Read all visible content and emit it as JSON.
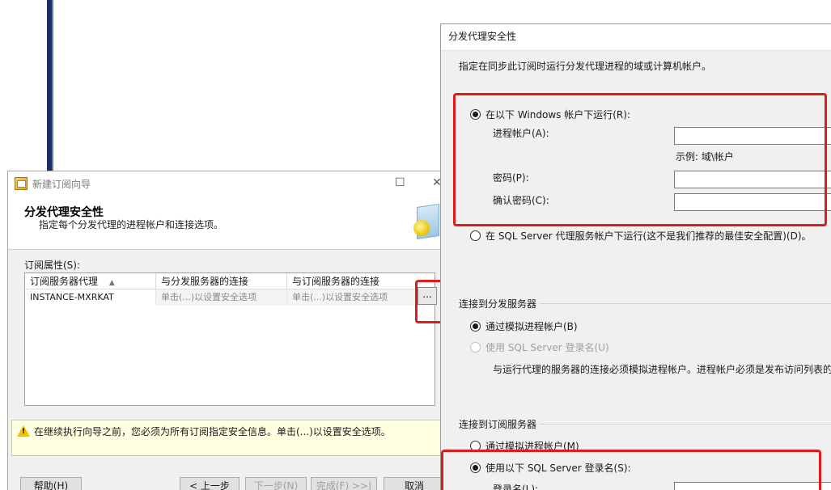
{
  "wizard": {
    "title": "新建订阅向导",
    "controls": {
      "maximize": "☐",
      "close": "✕"
    },
    "header_title": "分发代理安全性",
    "header_subtitle": "指定每个分发代理的进程帐户和连接选项。",
    "subscription_props_label": "订阅属性(S):",
    "grid": {
      "columns": [
        "订阅服务器代理",
        "与分发服务器的连接",
        "与订阅服务器的连接"
      ],
      "sort_glyph": "▲",
      "rows": [
        {
          "agent": "INSTANCE-MXRKAT",
          "dist_conn": "单击(...)以设置安全选项",
          "sub_conn": "单击(...)以设置安全选项"
        }
      ]
    },
    "ellipsis_label": "...",
    "warning": "在继续执行向导之前，您必须为所有订阅指定安全信息。单击(...)以设置安全选项。",
    "buttons": {
      "help": "帮助(H)",
      "back": "< 上一步",
      "next": "下一步(N)",
      "finish": "完成(F) >>|",
      "cancel": "取消"
    }
  },
  "dialog": {
    "title": "分发代理安全性",
    "intro": "指定在同步此订阅时运行分发代理进程的域或计算机帐户。",
    "run_as_windows": "在以下 Windows 帐户下运行(R):",
    "process_account_label": "进程帐户(A):",
    "example": "示例: 域\\帐户",
    "password_label": "密码(P):",
    "confirm_password_label": "确认密码(C):",
    "run_as_sql_agent": "在 SQL Server 代理服务帐户下运行(这不是我们推荐的最佳安全配置)(D)。",
    "connect_distributor_group": "连接到分发服务器",
    "dist_impersonate": "通过模拟进程帐户(B)",
    "dist_sql_login": "使用 SQL Server 登录名(U)",
    "dist_note": "与运行代理的服务器的连接必须模拟进程帐户。进程帐户必须是发布访问列表的",
    "connect_subscriber_group": "连接到订阅服务器",
    "sub_impersonate": "通过模拟进程帐户(M)",
    "sub_sql_login": "使用以下 SQL Server 登录名(S):",
    "login_name_label": "登录名(L):"
  },
  "colors": {
    "highlight": "#e01b1b",
    "warning_bg": "#ffffe1"
  },
  "icons": [
    "wizard-app-icon",
    "warning-icon",
    "security-graphic"
  ]
}
